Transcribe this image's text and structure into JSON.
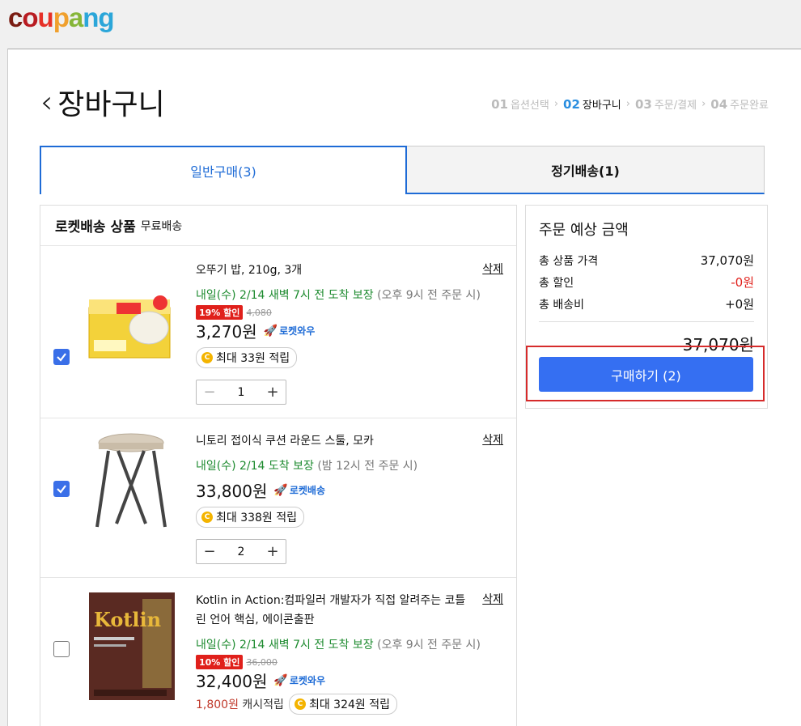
{
  "logo": {
    "c1": "c",
    "c2": "o",
    "c3": "u",
    "c4": "p",
    "c5": "a",
    "c6": "ng"
  },
  "page_title": "장바구니",
  "steps": [
    {
      "num": "01",
      "label": "옵션선택"
    },
    {
      "num": "02",
      "label": "장바구니"
    },
    {
      "num": "03",
      "label": "주문/결제"
    },
    {
      "num": "04",
      "label": "주문완료"
    }
  ],
  "tabs": {
    "general": "일반구매(3)",
    "regular": "정기배송(1)"
  },
  "section": {
    "title": "로켓배송 상품",
    "subtitle": "무료배송"
  },
  "delete_label": "삭제",
  "items": [
    {
      "name": "오뚜기 밥, 210g, 3개",
      "delivery": "내일(수) 2/14 새벽 7시 전 도착 보장",
      "delivery_note": "(오후 9시 전 주문 시)",
      "discount": "19% 할인",
      "original_price": "4,080",
      "price": "3,270원",
      "badge": "로켓와우",
      "cashback": "최대 33원 적립",
      "quantity": "1",
      "checked": true
    },
    {
      "name": "니토리 접이식 쿠션 라운드 스툴, 모카",
      "delivery": "내일(수) 2/14 도착 보장",
      "delivery_note": "(밤 12시 전 주문 시)",
      "price": "33,800원",
      "badge": "로켓배송",
      "cashback": "최대 338원 적립",
      "quantity": "2",
      "checked": true
    },
    {
      "name": "Kotlin in Action:컴파일러 개발자가 직접 알려주는 코틀린 언어 핵심, 에이콘출판",
      "delivery": "내일(수) 2/14 새벽 7시 전 도착 보장",
      "delivery_note": "(오후 9시 전 주문 시)",
      "discount": "10% 할인",
      "original_price": "36,000",
      "price": "32,400원",
      "badge": "로켓와우",
      "cash_amount": "1,800원",
      "cash_label": "캐시적립",
      "cashback": "최대 324원 적립",
      "checked": false
    }
  ],
  "summary": {
    "title": "주문 예상 금액",
    "rows": [
      {
        "label": "총 상품 가격",
        "value": "37,070원"
      },
      {
        "label": "총 할인",
        "value": "-0원"
      },
      {
        "label": "총 배송비",
        "value": "+0원"
      }
    ],
    "total": "37,070원",
    "buy_label": "구매하기 (2)"
  },
  "coin_symbol": "C",
  "minus": "−",
  "plus": "+",
  "back": "‹",
  "book_text": "Kotlin"
}
